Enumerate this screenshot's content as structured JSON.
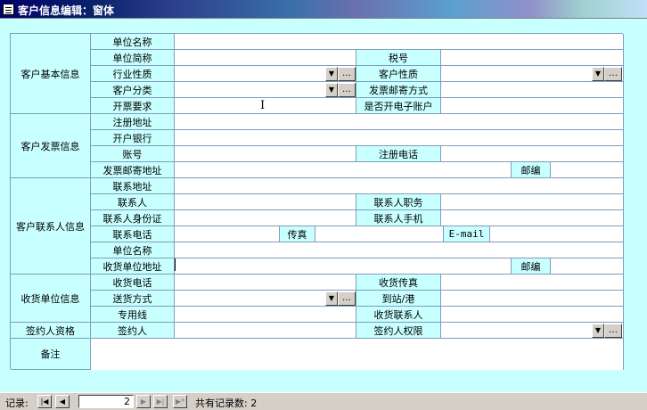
{
  "window": {
    "title": "客户信息编辑：窗体"
  },
  "groups": {
    "basic": "客户基本信息",
    "invoice": "客户发票信息",
    "contact": "客户联系人信息",
    "receiver": "收货单位信息",
    "signer_qual": "签约人资格",
    "remark": "备注"
  },
  "labels": {
    "company_name": "单位名称",
    "company_short": "单位简称",
    "tax_no": "税号",
    "industry": "行业性质",
    "customer_nature": "客户性质",
    "customer_category": "客户分类",
    "invoice_mail_method": "发票邮寄方式",
    "invoice_req": "开票要求",
    "e_account": "是否开电子账户",
    "reg_address": "注册地址",
    "bank": "开户银行",
    "account_no": "账号",
    "reg_phone": "注册电话",
    "invoice_mail_address": "发票邮寄地址",
    "postcode": "邮编",
    "contact_address": "联系地址",
    "contact_person": "联系人",
    "contact_title": "联系人职务",
    "contact_id": "联系人身份证",
    "contact_mobile": "联系人手机",
    "contact_phone": "联系电话",
    "fax": "传真",
    "email": "E-mail",
    "unit_name": "单位名称",
    "receiver_address": "收货单位地址",
    "postcode2": "邮编",
    "receiver_phone": "收货电话",
    "receiver_fax": "收货传真",
    "delivery_method": "送货方式",
    "station": "到站/港",
    "special_line": "专用线",
    "receiver_contact": "收货联系人",
    "signer": "签约人",
    "signer_rights": "签约人权限"
  },
  "nav": {
    "label": "记录:",
    "current": "2",
    "total_text": "共有记录数: 2"
  }
}
